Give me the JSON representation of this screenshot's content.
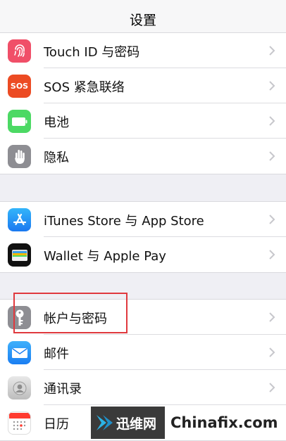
{
  "header": {
    "title": "设置"
  },
  "groups": [
    {
      "items": [
        {
          "label": "Touch ID 与密码",
          "icon": "fingerprint-icon",
          "color": "#f04f68"
        },
        {
          "label": "SOS 紧急联络",
          "icon": "sos-icon",
          "color": "#ec4b23",
          "icon_text": "SOS"
        },
        {
          "label": "电池",
          "icon": "battery-icon",
          "color": "#4cd964"
        },
        {
          "label": "隐私",
          "icon": "hand-icon",
          "color": "#8e8e93"
        }
      ]
    },
    {
      "items": [
        {
          "label": "iTunes Store 与 App Store",
          "icon": "app-store-icon",
          "color": "#1e96f5"
        },
        {
          "label": "Wallet 与 Apple Pay",
          "icon": "wallet-icon",
          "color": "#111111"
        }
      ]
    },
    {
      "items": [
        {
          "label": "帐户与密码",
          "icon": "key-icon",
          "color": "#8e8e93"
        },
        {
          "label": "邮件",
          "icon": "mail-icon",
          "color": "#1e8ef5"
        },
        {
          "label": "通讯录",
          "icon": "contacts-icon",
          "color": "#c7c7cc"
        },
        {
          "label": "日历",
          "icon": "calendar-icon",
          "color": "#ffffff"
        }
      ]
    }
  ],
  "watermark": {
    "brand_cn": "迅维网",
    "brand_en": "Chinafix.com"
  },
  "colors": {
    "highlight": "#e0393e",
    "chevron": "#c7c7cc"
  }
}
